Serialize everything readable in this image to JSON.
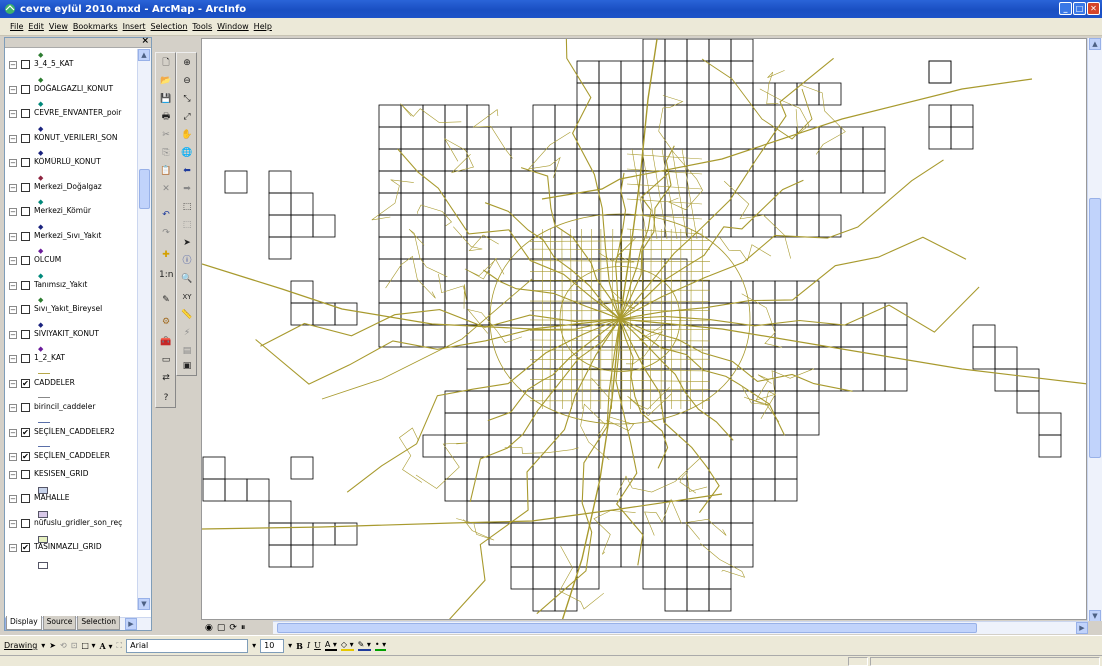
{
  "window": {
    "title": "cevre eylül 2010.mxd - ArcMap - ArcInfo",
    "controls": [
      "minimize",
      "maximize",
      "close"
    ]
  },
  "menu": [
    "File",
    "Edit",
    "View",
    "Bookmarks",
    "Insert",
    "Selection",
    "Tools",
    "Window",
    "Help"
  ],
  "toc": {
    "layers": [
      {
        "name": "3_4_5_KAT",
        "checked": false,
        "symbol_color": "#2e7d32"
      },
      {
        "name": "DOĞALGAZLI_KONUT",
        "checked": false,
        "symbol_color": "#2e7d32"
      },
      {
        "name": "CEVRE_ENVANTER_poir",
        "checked": false,
        "symbol_color": "#00897b"
      },
      {
        "name": "KONUT_VERILERI_SON",
        "checked": false,
        "symbol_color": "#1a237e"
      },
      {
        "name": "KÖMÜRLÜ_KONUT",
        "checked": false,
        "symbol_color": "#1a237e"
      },
      {
        "name": "Merkezi_Doğalgaz",
        "checked": false,
        "symbol_color": "#8e2440"
      },
      {
        "name": "Merkezi_Kömür",
        "checked": false,
        "symbol_color": "#00897b"
      },
      {
        "name": "Merkezi_Sıvı_Yakıt",
        "checked": false,
        "symbol_color": "#1a237e"
      },
      {
        "name": "OLCUM",
        "checked": false,
        "symbol_color": "#6a1b9a"
      },
      {
        "name": "Tanımsız_Yakıt",
        "checked": false,
        "symbol_color": "#00897b"
      },
      {
        "name": "Sıvı_Yakıt_Bireysel",
        "checked": false,
        "symbol_color": "#2e7d32"
      },
      {
        "name": "SIVIYAKIT_KONUT",
        "checked": false,
        "symbol_color": "#1a237e"
      },
      {
        "name": "1_2_KAT",
        "checked": false,
        "symbol_color": "#6a1b9a"
      },
      {
        "name": "CADDELER",
        "checked": true,
        "symbol_color": "#b7a84a"
      },
      {
        "name": "birincil_caddeler",
        "checked": false,
        "symbol_color": "#888888"
      },
      {
        "name": "SEÇİLEN_CADDELER2",
        "checked": true,
        "symbol_color": "#5a6fa8"
      },
      {
        "name": "SEÇİLEN_CADDELER",
        "checked": true,
        "symbol_color": "#5a6fa8"
      },
      {
        "name": "KESISEN_GRID",
        "checked": false,
        "symbol_color": "#c7d3ea"
      },
      {
        "name": "MAHALLE",
        "checked": false,
        "symbol_color": "#d8c8e8"
      },
      {
        "name": "nüfuslu_gridler_son_reç",
        "checked": false,
        "symbol_color": "#e6f0c0"
      },
      {
        "name": "TASINMAZLI_GRID",
        "checked": true,
        "symbol_color": "#ffffff"
      }
    ],
    "tabs": [
      "Display",
      "Source",
      "Selection"
    ],
    "active_tab": "Display"
  },
  "drawing": {
    "menu_label": "Drawing",
    "font_name": "Arial",
    "font_size": "10"
  },
  "colors": {
    "streets": "#a89a2e",
    "grid": "#000000",
    "title_bar": "#1a4fc2"
  }
}
